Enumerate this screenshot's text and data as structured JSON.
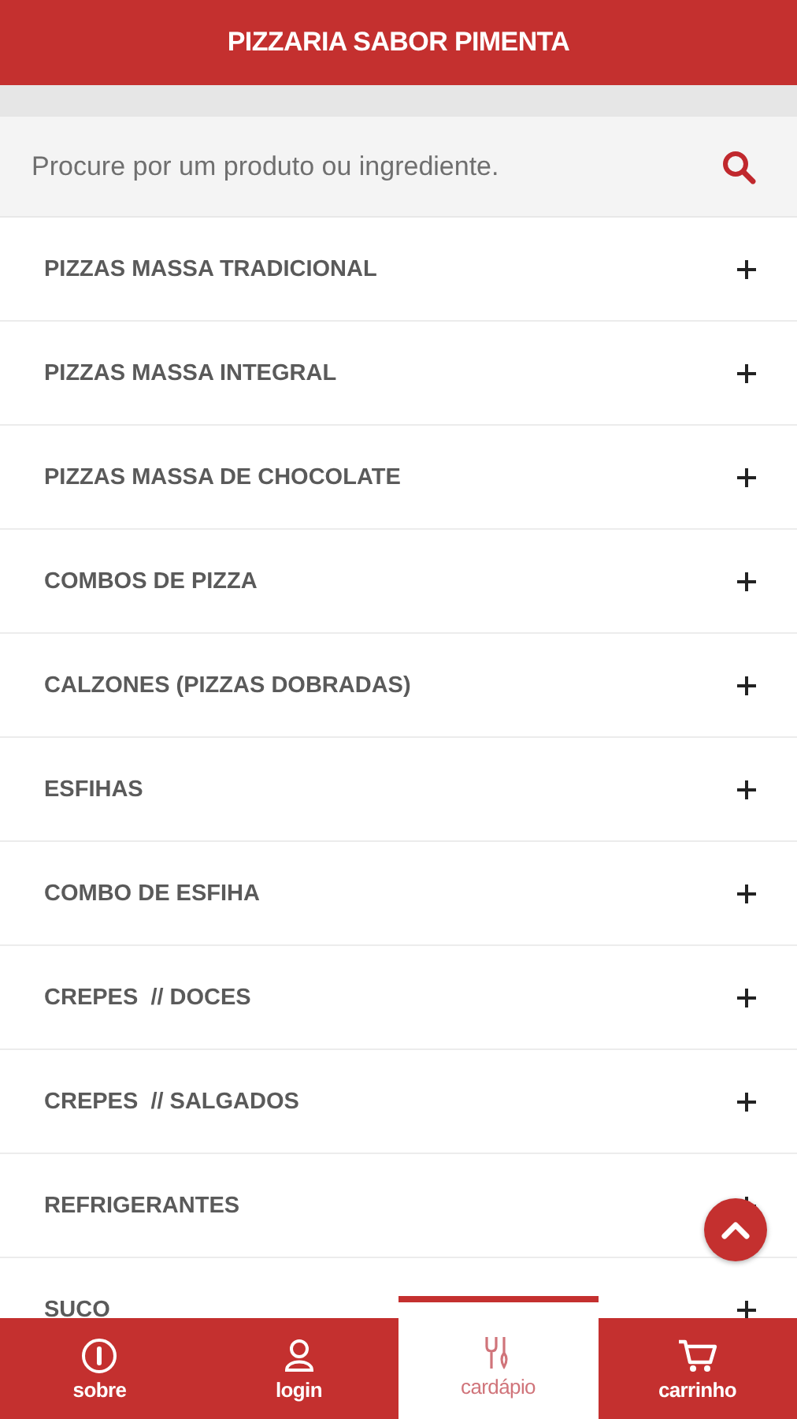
{
  "header": {
    "title": "PIZZARIA SABOR PIMENTA"
  },
  "search": {
    "placeholder": "Procure por um produto ou ingrediente."
  },
  "categories": [
    {
      "label": "PIZZAS MASSA TRADICIONAL",
      "expanded": false
    },
    {
      "label": "PIZZAS MASSA INTEGRAL",
      "expanded": false
    },
    {
      "label": "PIZZAS MASSA DE CHOCOLATE",
      "expanded": false
    },
    {
      "label": "COMBOS DE PIZZA",
      "expanded": false
    },
    {
      "label": "CALZONES (PIZZAS DOBRADAS)",
      "expanded": false
    },
    {
      "label": "ESFIHAS",
      "expanded": false
    },
    {
      "label": "COMBO DE ESFIHA",
      "expanded": false
    },
    {
      "label": "CREPES  **// DOCES**",
      "expanded": false
    },
    {
      "label": "CREPES  **// SALGADOS**",
      "expanded": false
    },
    {
      "label": "REFRIGERANTES",
      "expanded": false
    },
    {
      "label": "SUCO",
      "expanded": false
    }
  ],
  "nav": [
    {
      "kind": "info",
      "label": "sobre",
      "selected": false
    },
    {
      "kind": "user",
      "label": "login",
      "selected": false
    },
    {
      "kind": "menu",
      "label": "cardápio",
      "selected": true
    },
    {
      "kind": "cart",
      "label": "carrinho",
      "selected": false
    }
  ]
}
